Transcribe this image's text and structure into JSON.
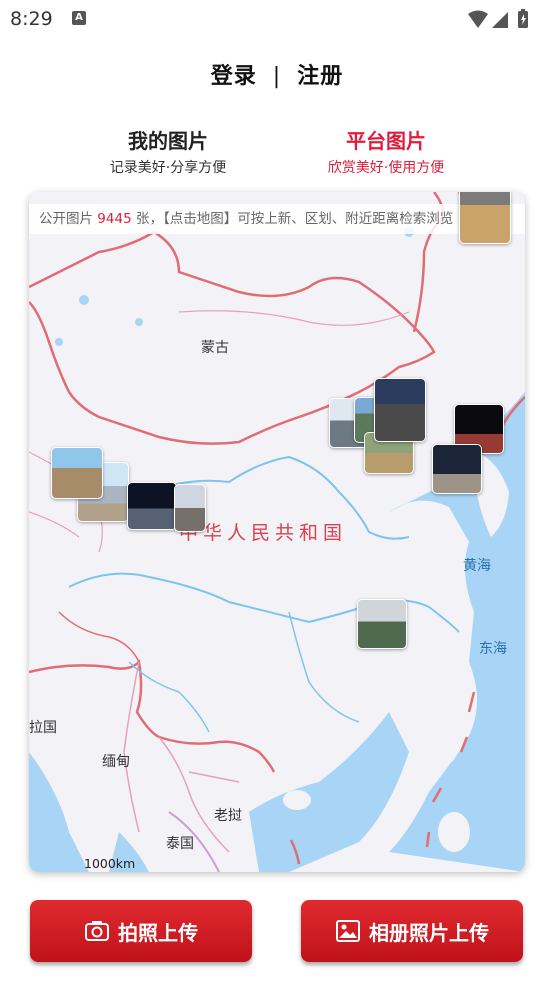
{
  "status_bar": {
    "time": "8:29",
    "badge": "A"
  },
  "auth": {
    "login": "登录",
    "separator": "|",
    "register": "注册"
  },
  "tabs": [
    {
      "title": "我的图片",
      "subtitle": "记录美好·分享方便",
      "active": false
    },
    {
      "title": "平台图片",
      "subtitle": "欣赏美好·使用方便",
      "active": true,
      "accent_color": "#e21d3b"
    }
  ],
  "map": {
    "info_prefix": "公开图片",
    "photo_count": "9445",
    "info_suffix": "张，【点击地图】可按上新、区划、附近距离检索浏览",
    "labels": {
      "mongolia": "蒙古",
      "china": "中华人民共和国",
      "yellow_sea": "黄海",
      "east_sea": "东海",
      "laos": "拉国",
      "myanmar": "缅甸",
      "laos2": "老挝",
      "thailand": "泰国"
    },
    "scale": "1000km"
  },
  "buttons": {
    "camera_upload": "拍照上传",
    "album_upload": "相册照片上传"
  }
}
